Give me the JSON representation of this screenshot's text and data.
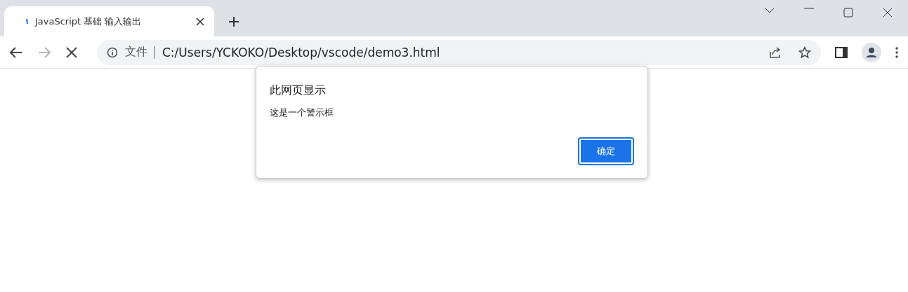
{
  "tabs": [
    {
      "title": "JavaScript 基础 输入输出",
      "selected": true,
      "loading": true
    }
  ],
  "toolbar": {
    "back": {
      "disabled": false
    },
    "forward": {
      "disabled": true
    },
    "security_label": "文件",
    "url": "C:/Users/YCKOKO/Desktop/vscode/demo3.html"
  },
  "dialog": {
    "title": "此网页显示",
    "message": "这是一个警示框",
    "button": "确定"
  }
}
